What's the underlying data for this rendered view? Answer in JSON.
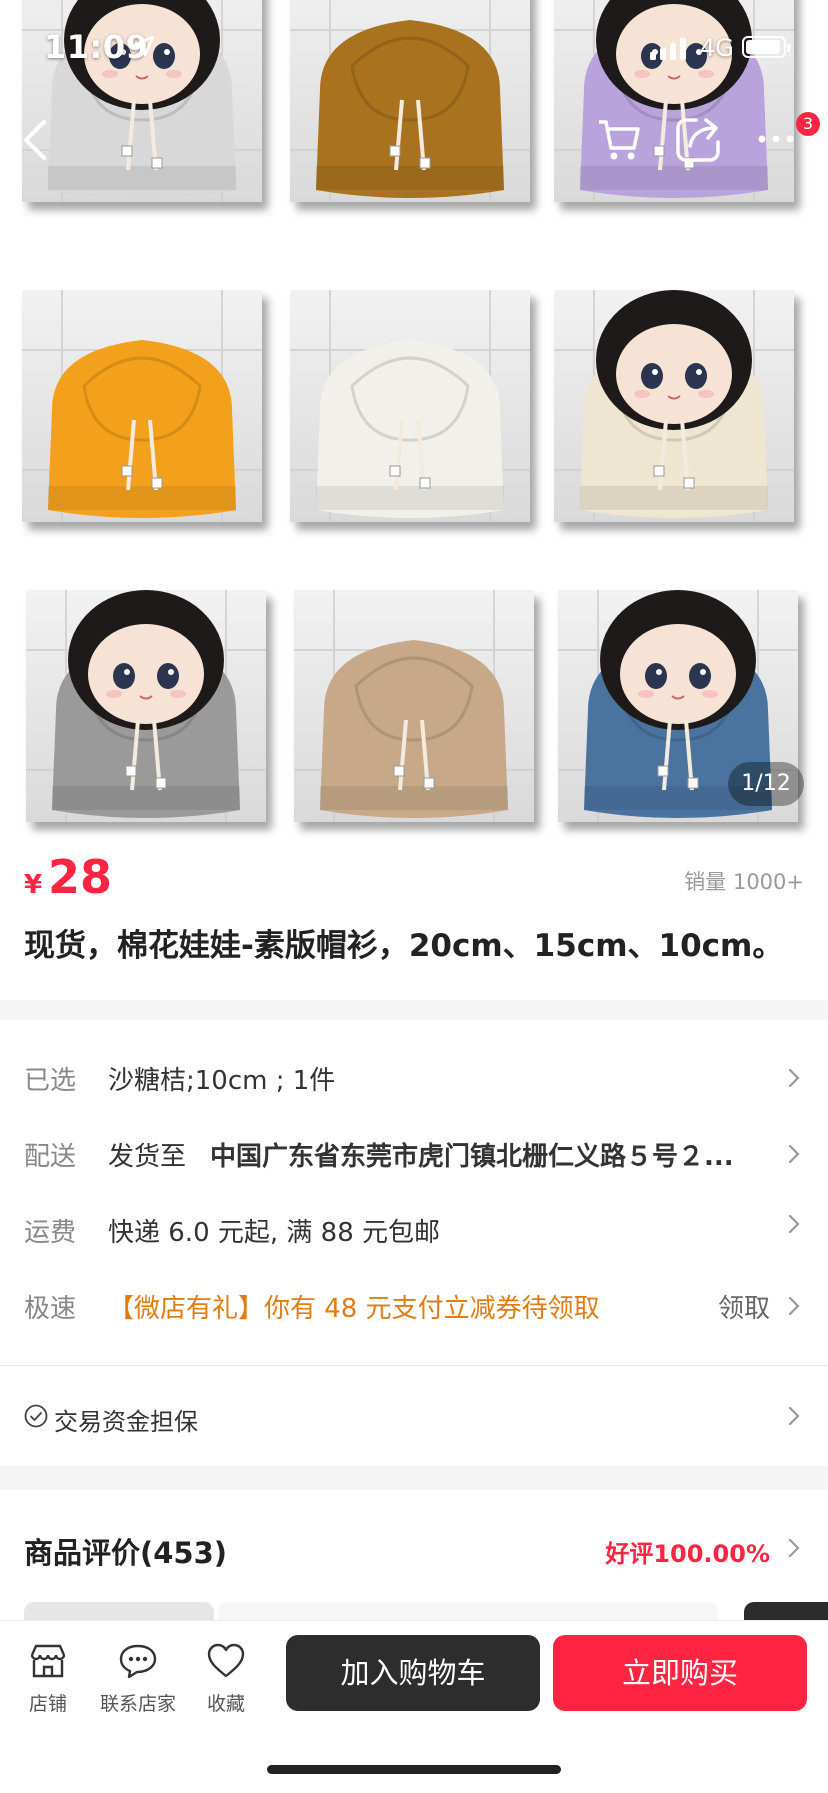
{
  "status": {
    "time": "11:09",
    "network": "4G"
  },
  "header": {
    "cart_badge": "3",
    "image_counter": "1/12"
  },
  "gallery": {
    "photos": [
      {
        "color": "#d8d8d8",
        "item": "gray-white hoodie doll"
      },
      {
        "color": "#a8721f",
        "item": "brown hoodie"
      },
      {
        "color": "#b9a3dc",
        "item": "lavender hoodie doll"
      },
      {
        "color": "#f3a11c",
        "item": "orange hoodie"
      },
      {
        "color": "#f2f0ea",
        "item": "white hoodie"
      },
      {
        "color": "#efe6d2",
        "item": "cream hoodie doll"
      },
      {
        "color": "#9a9a9a",
        "item": "gray hoodie doll"
      },
      {
        "color": "#c7a98a",
        "item": "khaki hoodie"
      },
      {
        "color": "#4a73a0",
        "item": "blue hoodie doll"
      }
    ]
  },
  "product": {
    "currency": "¥",
    "price": "28",
    "sales": "销量 1000+",
    "title": "现货，棉花娃娃-素版帽衫，20cm、15cm、10cm。"
  },
  "info": {
    "selected_label": "已选",
    "selected_value": "沙糖桔;10cm ; 1件",
    "delivery_label": "配送",
    "delivery_prefix": "发货至",
    "delivery_address": "中国广东省东莞市虎门镇北栅仁义路５号２...",
    "shipping_label": "运费",
    "shipping_value": "快递 6.0 元起, 满 88 元包邮",
    "speed_label": "极速",
    "speed_value": "【微店有礼】你有 48 元支付立减券待领取",
    "speed_action": "领取",
    "guarantee": "交易资金担保"
  },
  "reviews": {
    "title": "商品评价(453)",
    "good_rate": "好评100.00%"
  },
  "bottombar": {
    "shop": "店铺",
    "contact": "联系店家",
    "favorite": "收藏",
    "add_cart": "加入购物车",
    "buy_now": "立即购买"
  },
  "colors": {
    "accent": "#ff2442",
    "orange": "#e07d12",
    "dark_button": "#2d2d2d"
  }
}
